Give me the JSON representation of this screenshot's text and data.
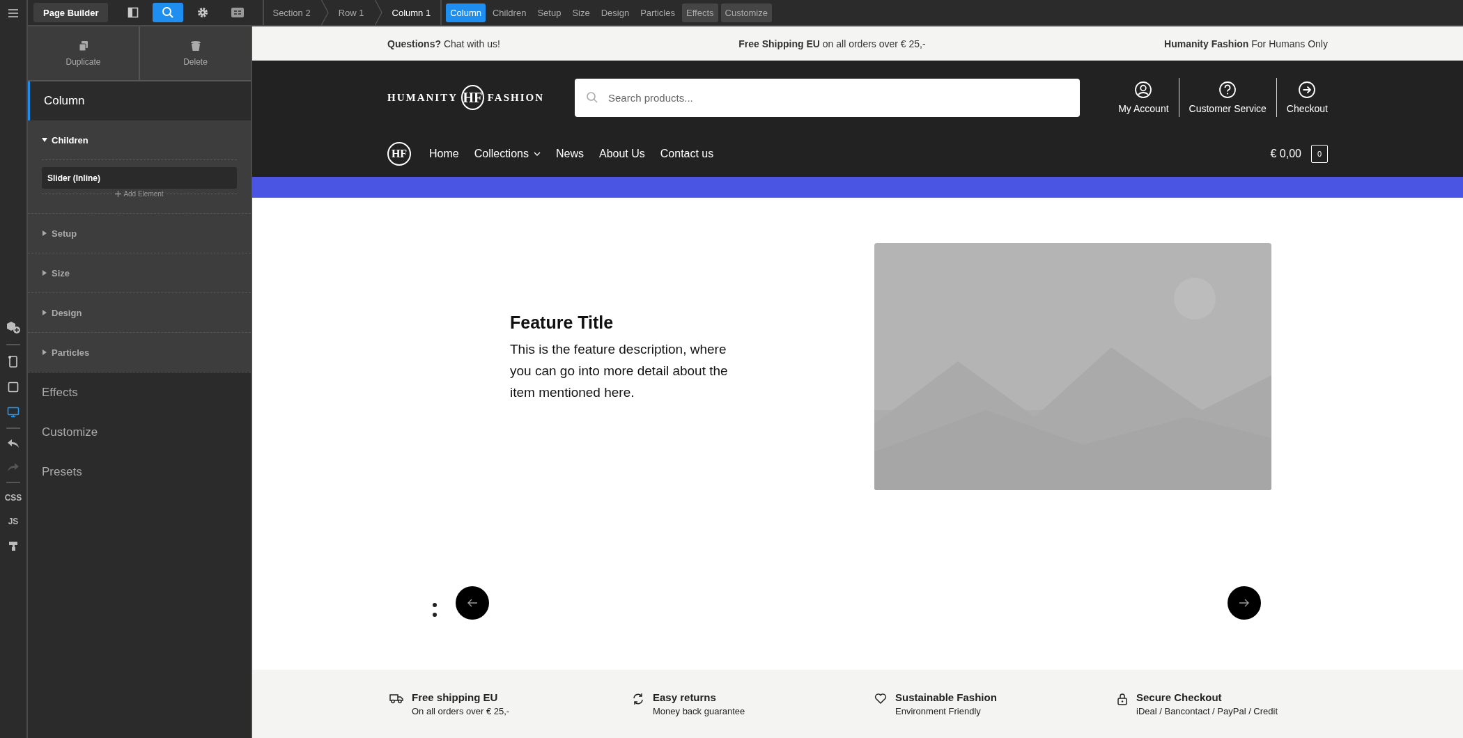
{
  "top_bar": {
    "app_button": "Page Builder",
    "tools": [
      {
        "kind": "panel",
        "selected": false
      },
      {
        "kind": "search",
        "selected": true
      },
      {
        "kind": "settings",
        "selected": false
      },
      {
        "kind": "code",
        "selected": false
      }
    ],
    "breadcrumbs": [
      {
        "label": "Section 2",
        "current": false
      },
      {
        "label": "Row 1",
        "current": false
      },
      {
        "label": "Column 1",
        "current": true
      }
    ],
    "tabs": [
      {
        "label": "Column",
        "selected": true,
        "boxed": false
      },
      {
        "label": "Children",
        "selected": false,
        "boxed": false
      },
      {
        "label": "Setup",
        "selected": false,
        "boxed": false
      },
      {
        "label": "Size",
        "selected": false,
        "boxed": false
      },
      {
        "label": "Design",
        "selected": false,
        "boxed": false
      },
      {
        "label": "Particles",
        "selected": false,
        "boxed": false
      },
      {
        "label": "Effects",
        "selected": false,
        "boxed": true
      },
      {
        "label": "Customize",
        "selected": false,
        "boxed": true
      }
    ]
  },
  "rail": {
    "devices": [
      {
        "kind": "mobile",
        "selected": false
      },
      {
        "kind": "tablet",
        "selected": false
      },
      {
        "kind": "desktop",
        "selected": true
      }
    ],
    "history": [
      {
        "kind": "undo",
        "disabled": false
      },
      {
        "kind": "redo",
        "disabled": true
      }
    ],
    "code": [
      "CSS",
      "JS"
    ]
  },
  "sidebar": {
    "actions": [
      {
        "kind": "duplicate",
        "label": "Duplicate"
      },
      {
        "kind": "delete",
        "label": "Delete"
      }
    ],
    "element_title": "Column",
    "sections": [
      {
        "label": "Children",
        "expanded": true,
        "children": [
          {
            "label": "Slider (Inline)"
          }
        ],
        "add_label": "Add Element"
      },
      {
        "label": "Setup",
        "expanded": false
      },
      {
        "label": "Size",
        "expanded": false
      },
      {
        "label": "Design",
        "expanded": false
      },
      {
        "label": "Particles",
        "expanded": false
      }
    ],
    "more": [
      "Effects",
      "Customize",
      "Presets"
    ]
  },
  "site": {
    "announcements": [
      "**Questions?** Chat with us!",
      "**Free Shipping EU** on all orders over € 25,-",
      "**Humanity Fashion** For Humans Only"
    ],
    "logo": {
      "left": "HUMANITY",
      "mark": "HF",
      "right": "FASHION"
    },
    "search": {
      "placeholder": "Search products..."
    },
    "header_links": [
      {
        "kind": "account",
        "label": "My Account"
      },
      {
        "kind": "help",
        "label": "Customer Service"
      },
      {
        "kind": "checkout",
        "label": "Checkout"
      }
    ],
    "nav_mark": "HF",
    "nav": [
      {
        "label": "Home",
        "dropdown": false
      },
      {
        "label": "Collections",
        "dropdown": true
      },
      {
        "label": "News",
        "dropdown": false
      },
      {
        "label": "About Us",
        "dropdown": false
      },
      {
        "label": "Contact us",
        "dropdown": false
      }
    ],
    "cart": {
      "total": "€ 0,00",
      "count": "0"
    },
    "hero": {
      "title": "Feature Title",
      "description": "This is the feature description, where you can go into more detail about the item mentioned here."
    },
    "features": [
      {
        "kind": "truck",
        "title": "Free shipping EU",
        "subtitle": "On all orders over € 25,-"
      },
      {
        "kind": "returns",
        "title": "Easy returns",
        "subtitle": "Money back guarantee"
      },
      {
        "kind": "heart",
        "title": "Sustainable Fashion",
        "subtitle": "Environment Friendly"
      },
      {
        "kind": "lock",
        "title": "Secure Checkout",
        "subtitle": "iDeal / Bancontact / PayPal / Credit"
      }
    ]
  }
}
